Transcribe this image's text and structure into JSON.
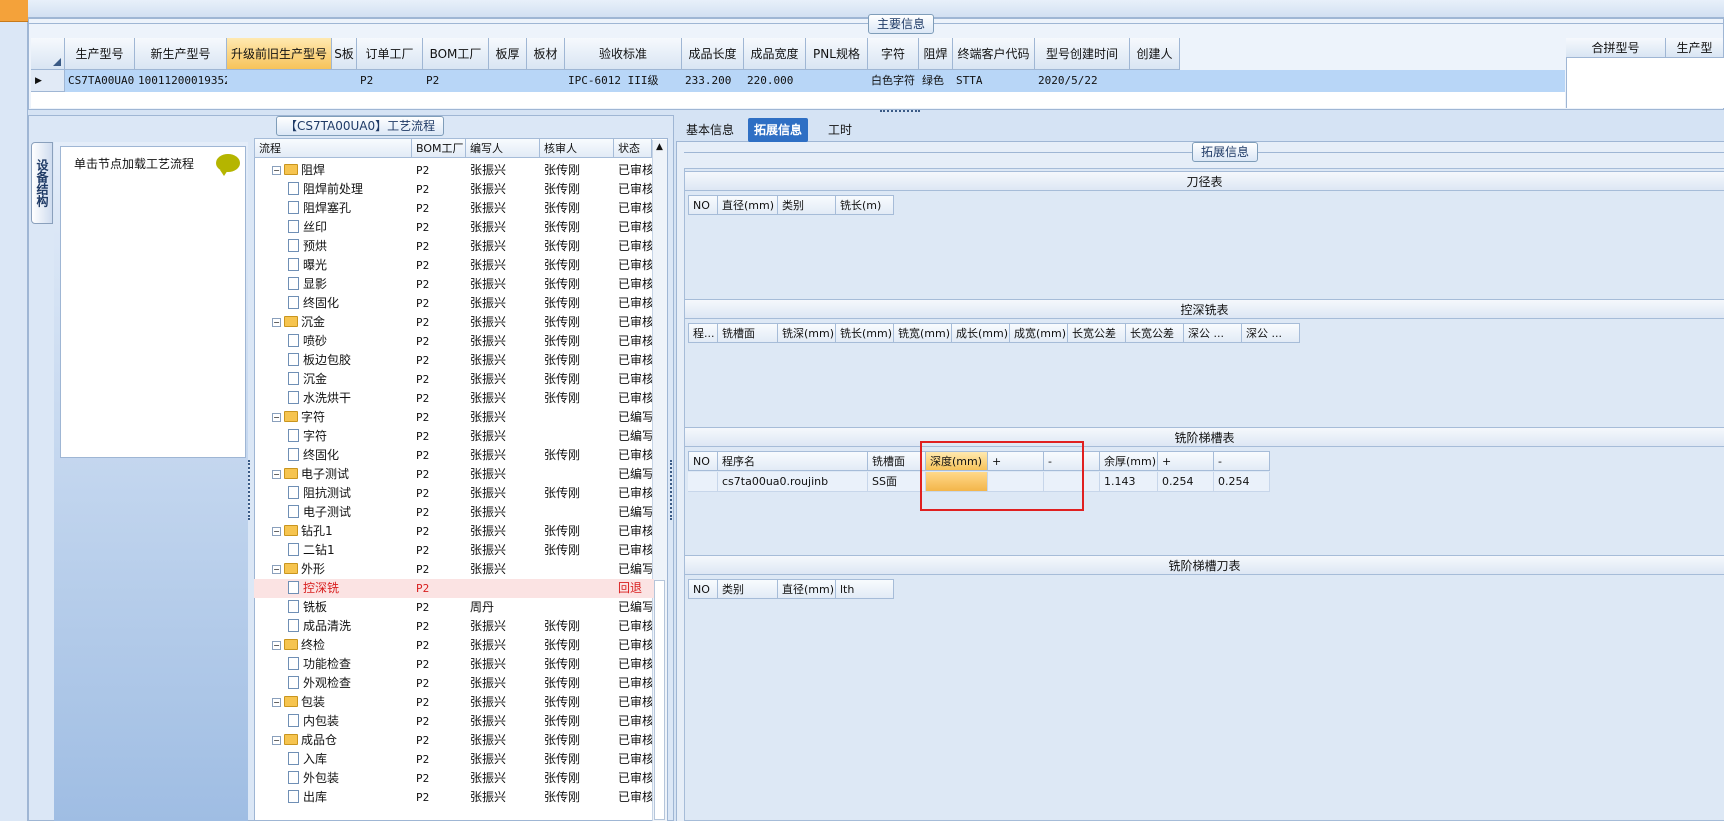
{
  "main_info_title": "主要信息",
  "main_grid": {
    "headers": [
      "生产型号",
      "新生产型号",
      "升级前旧生产型号",
      "S板",
      "订单工厂",
      "BOM工厂",
      "板厚",
      "板材",
      "验收标准",
      "成品长度",
      "成品宽度",
      "PNL规格",
      "字符",
      "阻焊",
      "终端客户代码",
      "型号创建时间",
      "创建人"
    ],
    "row": [
      "CS7TA00UA0",
      "10011200019352",
      "",
      "",
      "P2",
      "P2",
      "",
      "",
      "IPC-6012 III级",
      "233.200",
      "220.000",
      "",
      "白色字符",
      "绿色",
      "STTA",
      "2020/5/22",
      ""
    ],
    "right_headers": [
      "合拼型号",
      "生产型"
    ]
  },
  "flow_panel": {
    "title": "【CS7TA00UA0】工艺流程",
    "side_tab": "设备结构",
    "hint": "单击节点加载工艺流程",
    "cols": [
      "流程",
      "BOM工厂",
      "编写人",
      "核审人",
      "状态"
    ],
    "rows": [
      {
        "level": 1,
        "name": "阻焊",
        "bom": "P2",
        "writer": "张振兴",
        "reviewer": "张传刚",
        "status": "已审核"
      },
      {
        "level": 2,
        "name": "阻焊前处理",
        "bom": "P2",
        "writer": "张振兴",
        "reviewer": "张传刚",
        "status": "已审核"
      },
      {
        "level": 2,
        "name": "阻焊塞孔",
        "bom": "P2",
        "writer": "张振兴",
        "reviewer": "张传刚",
        "status": "已审核"
      },
      {
        "level": 2,
        "name": "丝印",
        "bom": "P2",
        "writer": "张振兴",
        "reviewer": "张传刚",
        "status": "已审核"
      },
      {
        "level": 2,
        "name": "预烘",
        "bom": "P2",
        "writer": "张振兴",
        "reviewer": "张传刚",
        "status": "已审核"
      },
      {
        "level": 2,
        "name": "曝光",
        "bom": "P2",
        "writer": "张振兴",
        "reviewer": "张传刚",
        "status": "已审核"
      },
      {
        "level": 2,
        "name": "显影",
        "bom": "P2",
        "writer": "张振兴",
        "reviewer": "张传刚",
        "status": "已审核"
      },
      {
        "level": 2,
        "name": "终固化",
        "bom": "P2",
        "writer": "张振兴",
        "reviewer": "张传刚",
        "status": "已审核"
      },
      {
        "level": 1,
        "name": "沉金",
        "bom": "P2",
        "writer": "张振兴",
        "reviewer": "张传刚",
        "status": "已审核"
      },
      {
        "level": 2,
        "name": "喷砂",
        "bom": "P2",
        "writer": "张振兴",
        "reviewer": "张传刚",
        "status": "已审核"
      },
      {
        "level": 2,
        "name": "板边包胶",
        "bom": "P2",
        "writer": "张振兴",
        "reviewer": "张传刚",
        "status": "已审核"
      },
      {
        "level": 2,
        "name": "沉金",
        "bom": "P2",
        "writer": "张振兴",
        "reviewer": "张传刚",
        "status": "已审核"
      },
      {
        "level": 2,
        "name": "水洗烘干",
        "bom": "P2",
        "writer": "张振兴",
        "reviewer": "张传刚",
        "status": "已审核"
      },
      {
        "level": 1,
        "name": "字符",
        "bom": "P2",
        "writer": "张振兴",
        "reviewer": "",
        "status": "已编写"
      },
      {
        "level": 2,
        "name": "字符",
        "bom": "P2",
        "writer": "张振兴",
        "reviewer": "",
        "status": "已编写"
      },
      {
        "level": 2,
        "name": "终固化",
        "bom": "P2",
        "writer": "张振兴",
        "reviewer": "张传刚",
        "status": "已审核"
      },
      {
        "level": 1,
        "name": "电子测试",
        "bom": "P2",
        "writer": "张振兴",
        "reviewer": "",
        "status": "已编写"
      },
      {
        "level": 2,
        "name": "阻抗测试",
        "bom": "P2",
        "writer": "张振兴",
        "reviewer": "张传刚",
        "status": "已审核"
      },
      {
        "level": 2,
        "name": "电子测试",
        "bom": "P2",
        "writer": "张振兴",
        "reviewer": "",
        "status": "已编写"
      },
      {
        "level": 1,
        "name": "钻孔1",
        "bom": "P2",
        "writer": "张振兴",
        "reviewer": "张传刚",
        "status": "已审核"
      },
      {
        "level": 2,
        "name": "二钻1",
        "bom": "P2",
        "writer": "张振兴",
        "reviewer": "张传刚",
        "status": "已审核"
      },
      {
        "level": 1,
        "name": "外形",
        "bom": "P2",
        "writer": "张振兴",
        "reviewer": "",
        "status": "已编写"
      },
      {
        "level": 2,
        "name": "控深铣",
        "bom": "P2",
        "writer": "",
        "reviewer": "",
        "status": "回退",
        "red": true
      },
      {
        "level": 2,
        "name": "铣板",
        "bom": "P2",
        "writer": "周丹",
        "reviewer": "",
        "status": "已编写"
      },
      {
        "level": 2,
        "name": "成品清洗",
        "bom": "P2",
        "writer": "张振兴",
        "reviewer": "张传刚",
        "status": "已审核"
      },
      {
        "level": 1,
        "name": "终检",
        "bom": "P2",
        "writer": "张振兴",
        "reviewer": "张传刚",
        "status": "已审核"
      },
      {
        "level": 2,
        "name": "功能检查",
        "bom": "P2",
        "writer": "张振兴",
        "reviewer": "张传刚",
        "status": "已审核"
      },
      {
        "level": 2,
        "name": "外观检查",
        "bom": "P2",
        "writer": "张振兴",
        "reviewer": "张传刚",
        "status": "已审核"
      },
      {
        "level": 1,
        "name": "包装",
        "bom": "P2",
        "writer": "张振兴",
        "reviewer": "张传刚",
        "status": "已审核"
      },
      {
        "level": 2,
        "name": "内包装",
        "bom": "P2",
        "writer": "张振兴",
        "reviewer": "张传刚",
        "status": "已审核"
      },
      {
        "level": 1,
        "name": "成品仓",
        "bom": "P2",
        "writer": "张振兴",
        "reviewer": "张传刚",
        "status": "已审核"
      },
      {
        "level": 2,
        "name": "入库",
        "bom": "P2",
        "writer": "张振兴",
        "reviewer": "张传刚",
        "status": "已审核"
      },
      {
        "level": 2,
        "name": "外包装",
        "bom": "P2",
        "writer": "张振兴",
        "reviewer": "张传刚",
        "status": "已审核"
      },
      {
        "level": 2,
        "name": "出库",
        "bom": "P2",
        "writer": "张振兴",
        "reviewer": "张传刚",
        "status": "已审核"
      }
    ]
  },
  "tabs": [
    "基本信息",
    "拓展信息",
    "工时"
  ],
  "ext_title": "拓展信息",
  "tool_table": {
    "title": "刀径表",
    "cols": [
      "NO",
      "直径(mm)",
      "类别",
      "铣长(m)"
    ]
  },
  "depth_table": {
    "title": "控深铣表",
    "cols": [
      "程...",
      "铣槽面",
      "铣深(mm)",
      "铣长(mm)",
      "铣宽(mm)",
      "成长(mm)",
      "成宽(mm)",
      "长宽公差",
      "长宽公差",
      "深公 ...",
      "深公 ..."
    ]
  },
  "step_table": {
    "title": "铣阶梯槽表",
    "cols": [
      "NO",
      "程序名",
      "铣槽面",
      "深度(mm)",
      "+",
      "-",
      "余厚(mm)",
      "+",
      "-"
    ],
    "row": [
      "",
      "cs7ta00ua0.roujinb",
      "SS面",
      "",
      "",
      "",
      "1.143",
      "0.254",
      "0.254"
    ]
  },
  "step_tool_table": {
    "title": "铣阶梯槽刀表",
    "cols": [
      "NO",
      "类别",
      "直径(mm)",
      "lth"
    ]
  }
}
